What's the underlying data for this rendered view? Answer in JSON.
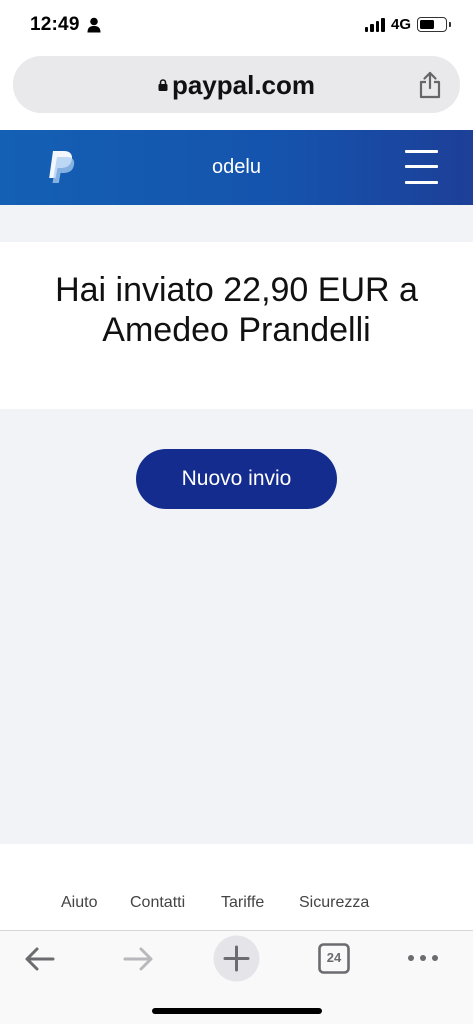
{
  "status_bar": {
    "time": "12:49",
    "network": "4G",
    "battery_level": 0.6
  },
  "browser": {
    "url": "paypal.com",
    "tab_count": "24"
  },
  "header": {
    "username": "odelu",
    "brand_color": "#1460b4"
  },
  "confirmation": {
    "message": "Hai inviato 22,90 EUR a Amedeo Prandelli"
  },
  "actions": {
    "new_send_label": "Nuovo invio",
    "button_color": "#142c8e"
  },
  "footer": {
    "links": [
      "Aiuto",
      "Contatti",
      "Tariffe",
      "Sicurezza"
    ]
  },
  "icons": {
    "status": [
      "person-icon",
      "signal-icon",
      "battery-icon"
    ],
    "browser": [
      "lock-icon",
      "share-icon"
    ],
    "header": [
      "paypal-logo-icon",
      "hamburger-menu-icon"
    ],
    "toolbar": [
      "back-arrow-icon",
      "forward-arrow-icon",
      "plus-icon",
      "tabs-icon",
      "more-icon"
    ]
  }
}
